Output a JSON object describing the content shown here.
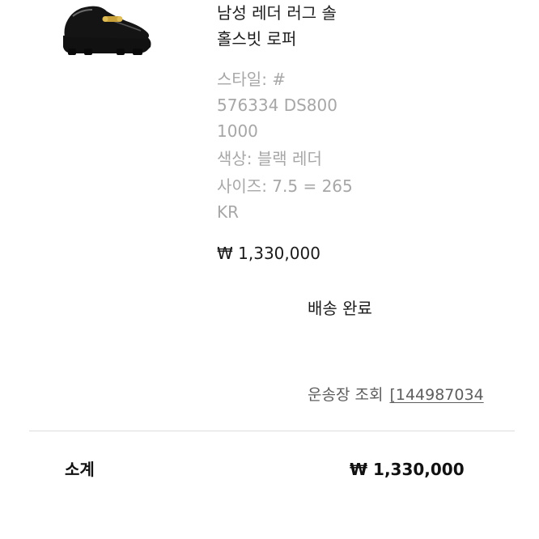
{
  "order_item": {
    "product_name_line1": "남성 레더 러그 솔",
    "product_name_line2": "홀스빗 로퍼",
    "style_line1": "스타일: #",
    "style_line2": "576334 DS800",
    "style_line3": "1000",
    "color": "색상: 블랙 레더",
    "size_line1": "사이즈: 7.5 = 265",
    "size_line2": "KR",
    "price": "₩ 1,330,000",
    "thumbnail_icon": "loafer-shoe-image"
  },
  "delivery": {
    "status": "배송 완료",
    "tracking_label": "운송장 조회",
    "tracking_number": "[144987034"
  },
  "summary": {
    "subtotal_label": "소계",
    "subtotal_value": "₩ 1,330,000"
  }
}
